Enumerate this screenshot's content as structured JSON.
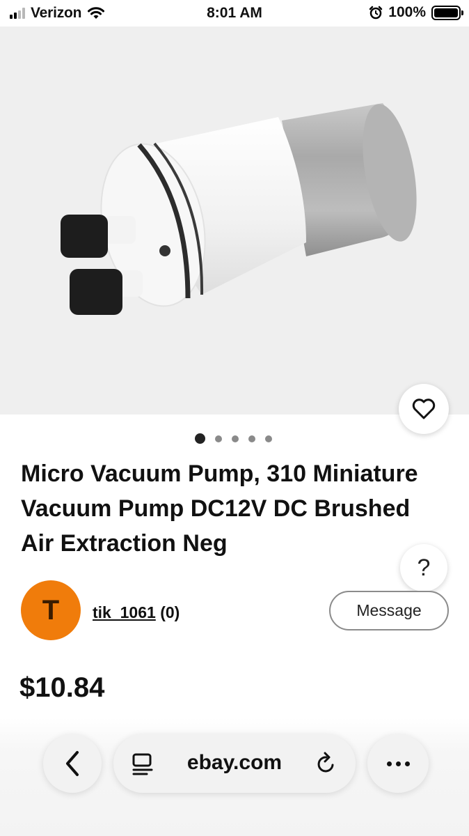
{
  "status_bar": {
    "carrier": "Verizon",
    "time": "8:01 AM",
    "battery": "100%"
  },
  "product": {
    "title": "Micro Vacuum Pump, 310 Miniature Vacuum Pump DC12V DC Brushed Air Extraction Neg",
    "price": "$10.84",
    "image_count": 5,
    "current_image": 1
  },
  "seller": {
    "initial": "T",
    "name": "tik_1061",
    "feedback": "(0)",
    "avatar_color": "#f07c0b"
  },
  "actions": {
    "message_label": "Message",
    "help_label": "?"
  },
  "browser": {
    "url": "ebay.com"
  },
  "icons": [
    "wifi-icon",
    "alarm-icon",
    "heart-icon",
    "back-icon",
    "reader-icon",
    "reload-icon",
    "more-icon"
  ]
}
